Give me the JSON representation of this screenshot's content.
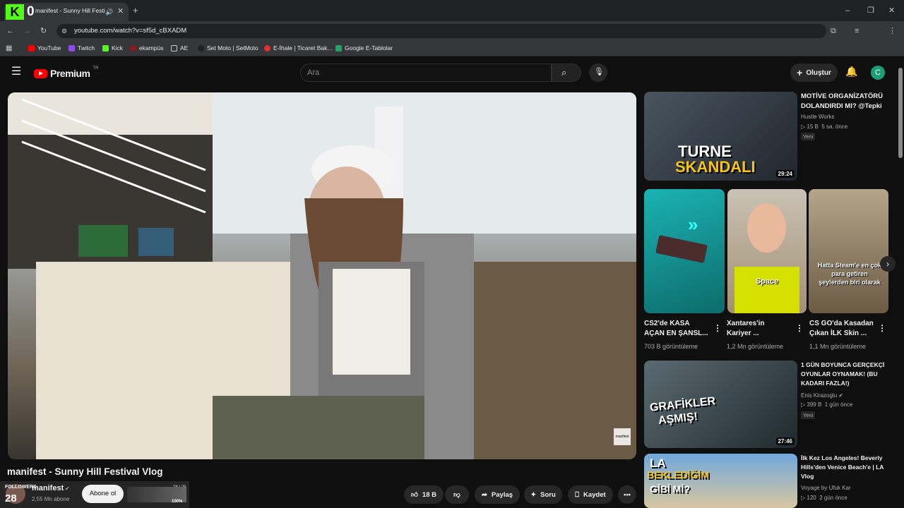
{
  "browser": {
    "tab_title": "manifest - Sunny Hill Festi",
    "url": "youtube.com/watch?v=sf5d_cBXADM",
    "kick_count": "0",
    "bookmarks": [
      "YouTube",
      "Twitch",
      "Kick",
      "ekampüs",
      "AE",
      "Set Moto | SetMoto",
      "E-İhale | Ticaret Bak...",
      "Google E-Tablolar"
    ]
  },
  "youtube": {
    "logo_text": "Premium",
    "logo_badge": "TR",
    "search_placeholder": "Ara",
    "create_label": "Oluştur",
    "avatar_letter": "C"
  },
  "video": {
    "title": "manifest - Sunny Hill Festival Vlog",
    "watermark": "manifest",
    "channel_name": "manifest",
    "subscribers": "2,55 Mn abone",
    "subscribe_label": "Abone ol",
    "likes": "18 B",
    "share_label": "Paylaş",
    "ask_label": "Soru",
    "save_label": "Kaydet"
  },
  "stream_overlay": {
    "followers_label": "FOLLOWERS",
    "followers_count": "28",
    "goal": "28 / 25",
    "percent": "100%"
  },
  "sidebar": {
    "videos": [
      {
        "title_line1": "MOTİVE ORGANİZATÖRÜ",
        "title_line2": "DOLANDIRDI MI? @Tepki",
        "channel": "Hustle Works",
        "views": "15 B",
        "age": "5 sa. önce",
        "badge": "Yeni",
        "duration": "29:24",
        "thumb_text1": "TURNE",
        "thumb_text2": "SKANDALI"
      },
      {
        "title_line1": "1 GÜN BOYUNCA GERÇEKÇİ",
        "title_line2": "OYUNLAR OYNAMAK! (BU",
        "title_line3": "KADARI FAZLA!)",
        "channel": "Enis Kirazoglu",
        "views": "399 B",
        "age": "1 gün önce",
        "badge": "Yeni",
        "duration": "27:46",
        "thumb_text1": "GRAFİKLER",
        "thumb_text2": "AŞMIŞ!"
      },
      {
        "title_line1": "İlk Kez Los Angeles! Beverly",
        "title_line2": "Hills'den Venice Beach'e | LA",
        "title_line3": "Vlog",
        "channel": "Voyage by Ufuk Kar",
        "views": "120",
        "age": "2 gün önce",
        "thumb_text1": "LA",
        "thumb_text2": "BEKLEDİĞİM",
        "thumb_text3": "GİBİ Mİ?"
      }
    ],
    "shorts": [
      {
        "title_line1": "CS2'de KASA",
        "title_line2": "AÇAN EN ŞANSL...",
        "views": "703 B görüntüleme"
      },
      {
        "title_line1": "Xantares'in",
        "title_line2": "Kariyer ...",
        "views": "1,2 Mn görüntüleme",
        "thumb_text": "Space"
      },
      {
        "title_line1": "CS GO'da Kasadan",
        "title_line2": "Çıkan İLK Skin ...",
        "views": "1,1 Mn görüntüleme",
        "thumb_text": "Hatta Steam'e en çok para getiren şeylerden biri olarak"
      }
    ]
  }
}
